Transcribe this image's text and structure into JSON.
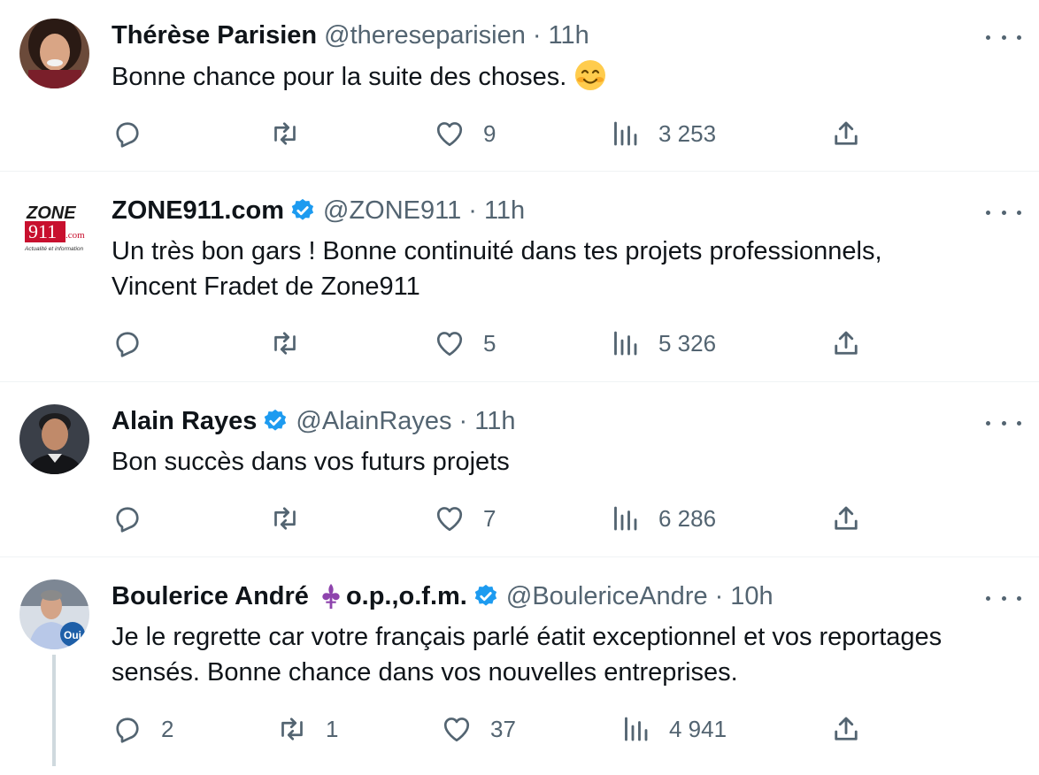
{
  "tweets": [
    {
      "name": "Thérèse Parisien",
      "handle": "@thereseparisien",
      "time": "11h",
      "verified": false,
      "text": "Bonne chance pour la suite des choses.",
      "emoji": "smiling-blushing-face",
      "replies": "",
      "retweets": "",
      "likes": "9",
      "views": "3 253",
      "avatar": "woman-dark-hair-photo"
    },
    {
      "name": "ZONE911.com",
      "handle": "@ZONE911",
      "time": "11h",
      "verified": true,
      "text_line1": "Un très bon gars ! Bonne continuité dans tes projets professionnels,",
      "text_line2": "Vincent Fradet de Zone911",
      "replies": "",
      "retweets": "",
      "likes": "5",
      "views": "5 326",
      "logo": {
        "line1": "ZONE",
        "num": "911",
        "com": ".com",
        "tagline": "Actualité et information"
      }
    },
    {
      "name": "Alain Rayes",
      "handle": "@AlainRayes",
      "time": "11h",
      "verified": true,
      "text": "Bon succès dans vos futurs projets",
      "replies": "",
      "retweets": "",
      "likes": "7",
      "views": "6 286",
      "avatar": "man-portrait-photo"
    },
    {
      "name": "Boulerice André",
      "name_suffix": "o.p.,o.f.m.",
      "handle": "@BoulericeAndre",
      "time": "10h",
      "verified": true,
      "text_line1": "Je le regrette car votre français parlé éatit exceptionnel et vos reportages",
      "text_line2": "sensés. Bonne chance dans vos nouvelles entreprises.",
      "replies": "2",
      "retweets": "1",
      "likes": "37",
      "views": "4 941",
      "avatar_badge": "Oui"
    }
  ],
  "colors": {
    "verified": "#1d9bf0",
    "muted": "#536471",
    "divider": "#eff3f4",
    "fleur": "#8e44ad"
  }
}
